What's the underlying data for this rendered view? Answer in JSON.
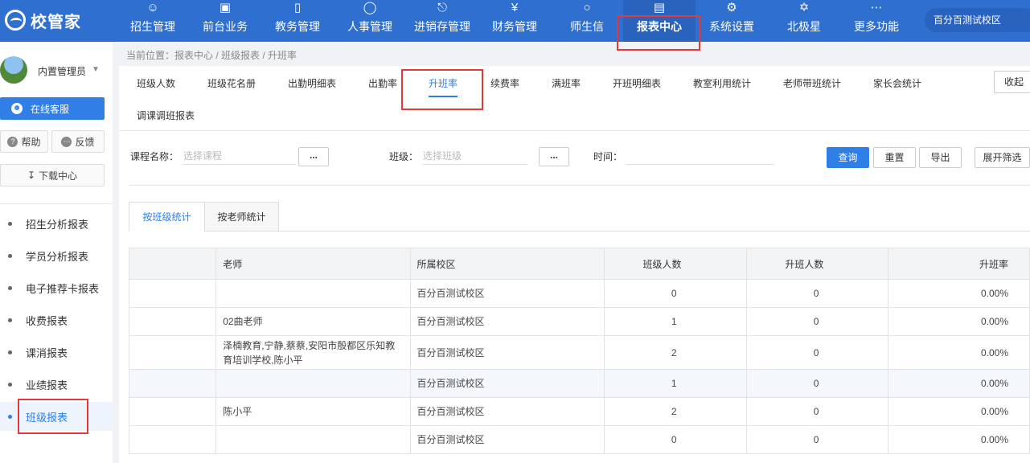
{
  "logo": {
    "text": "校管家"
  },
  "nav": [
    {
      "label": "招生管理",
      "icon": "user-add-icon"
    },
    {
      "label": "前台业务",
      "icon": "monitor-icon"
    },
    {
      "label": "教务管理",
      "icon": "book-icon"
    },
    {
      "label": "人事管理",
      "icon": "person-icon"
    },
    {
      "label": "进销存管理",
      "icon": "box-arrow-icon"
    },
    {
      "label": "财务管理",
      "icon": "yen-icon"
    },
    {
      "label": "师生信",
      "icon": "chat-icon"
    },
    {
      "label": "报表中心",
      "icon": "chart-icon"
    },
    {
      "label": "系统设置",
      "icon": "gear-icon"
    },
    {
      "label": "北极星",
      "icon": "star-icon"
    },
    {
      "label": "更多功能",
      "icon": "more-icon"
    }
  ],
  "school": "百分百测试校区",
  "user": {
    "name": "内置管理员"
  },
  "sidebar": {
    "service": "在线客服",
    "help": "帮助",
    "feedback": "反馈",
    "download": "下载中心",
    "items": [
      {
        "label": "招生分析报表"
      },
      {
        "label": "学员分析报表"
      },
      {
        "label": "电子推荐卡报表"
      },
      {
        "label": "收费报表"
      },
      {
        "label": "课消报表"
      },
      {
        "label": "业绩报表"
      },
      {
        "label": "班级报表"
      }
    ]
  },
  "breadcrumb": "当前位置：报表中心 / 班级报表 / 升班率",
  "report_tabs": [
    {
      "label": "班级人数"
    },
    {
      "label": "班级花名册"
    },
    {
      "label": "出勤明细表"
    },
    {
      "label": "出勤率"
    },
    {
      "label": "升班率"
    },
    {
      "label": "续费率"
    },
    {
      "label": "满班率"
    },
    {
      "label": "开班明细表"
    },
    {
      "label": "教室利用统计"
    },
    {
      "label": "老师带班统计"
    },
    {
      "label": "家长会统计"
    },
    {
      "label": "调课调班报表"
    }
  ],
  "collapse_label": "收起",
  "filters": {
    "course_label": "课程名称：",
    "course_placeholder": "选择课程",
    "class_label": "班级：",
    "class_placeholder": "选择班级",
    "time_label": "时间：",
    "dots": "..."
  },
  "buttons": {
    "query": "查询",
    "reset": "重置",
    "export": "导出",
    "expand": "展开筛选"
  },
  "sub_tabs": [
    {
      "label": "按班级统计"
    },
    {
      "label": "按老师统计"
    }
  ],
  "table": {
    "headers": [
      "",
      "老师",
      "所属校区",
      "班级人数",
      "升班人数",
      "升班率"
    ],
    "rows": [
      [
        "",
        "",
        "百分百测试校区",
        "0",
        "0",
        "0.00%"
      ],
      [
        "",
        "02曲老师",
        "百分百测试校区",
        "1",
        "0",
        "0.00%"
      ],
      [
        "",
        "泽楠教育,宁静,蔡蔡,安阳市殷都区乐知教育培训学校,陈小平",
        "百分百测试校区",
        "2",
        "0",
        "0.00%"
      ],
      [
        "",
        "",
        "百分百测试校区",
        "1",
        "0",
        "0.00%"
      ],
      [
        "",
        "陈小平",
        "百分百测试校区",
        "2",
        "0",
        "0.00%"
      ],
      [
        "",
        "",
        "百分百测试校区",
        "0",
        "0",
        "0.00%"
      ]
    ]
  },
  "colors": {
    "topbar": "#2f6fd0",
    "accent": "#2f7fe6",
    "highlight": "#e23a3a"
  }
}
